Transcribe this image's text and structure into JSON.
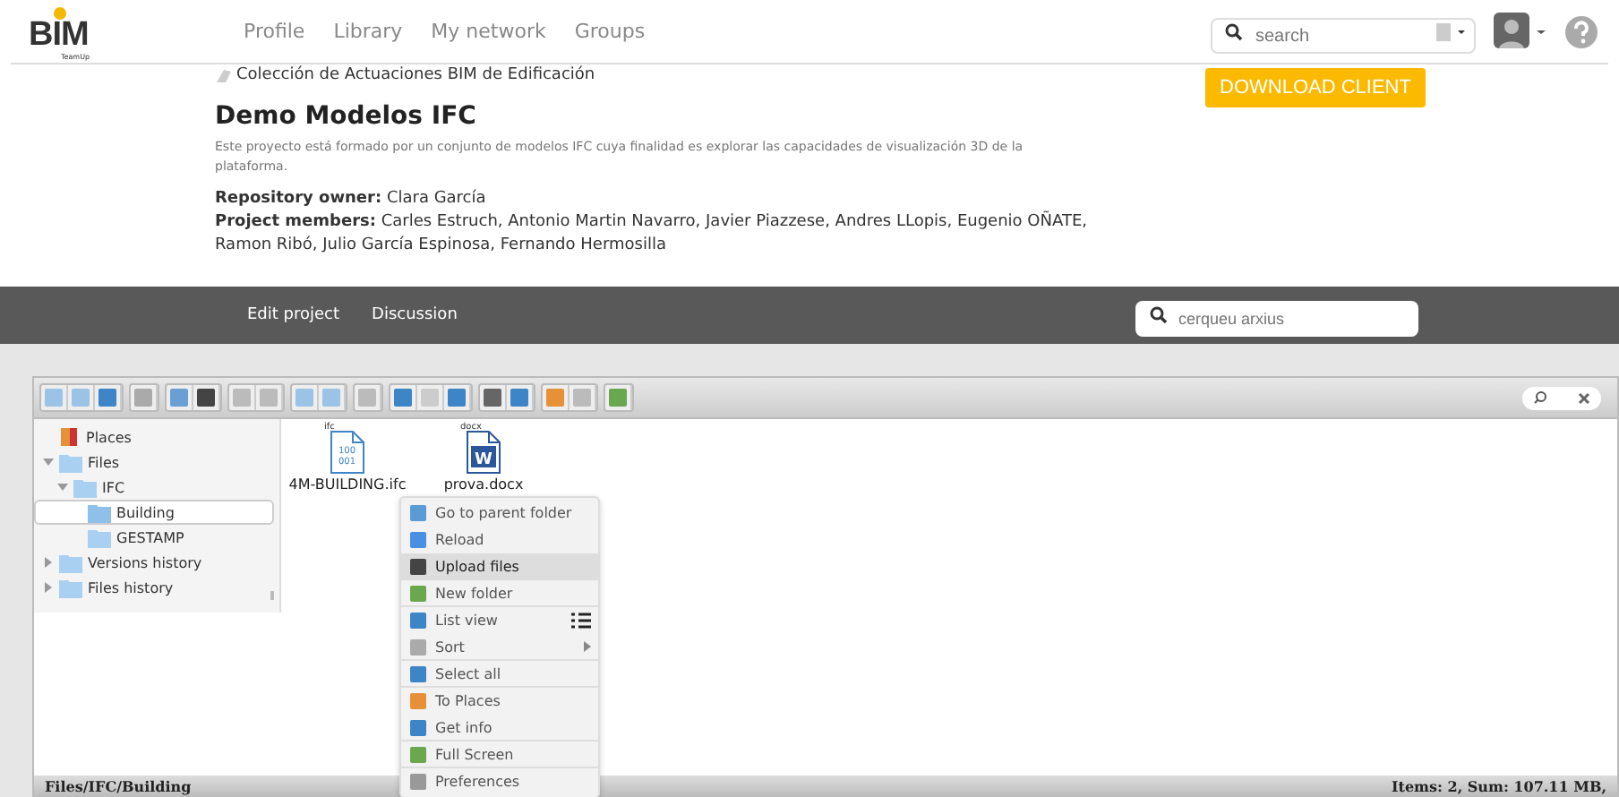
{
  "logo": {
    "text": "BIM",
    "subtitle": "TeamUp"
  },
  "nav": [
    {
      "label": "Profile"
    },
    {
      "label": "Library"
    },
    {
      "label": "My network"
    },
    {
      "label": "Groups"
    }
  ],
  "search": {
    "placeholder": "search"
  },
  "download_button": "DOWNLOAD CLIENT",
  "collection": "Colección de Actuaciones BIM de Edificación",
  "project": {
    "title": "Demo Modelos IFC",
    "description": "Este proyecto está formado por un conjunto de modelos IFC cuya finalidad es explorar las capacidades de visualización 3D de la plataforma.",
    "owner": "**Repository owner:** Clara García",
    "members": "**Project members:** Carles Estruch, Antonio Martin Navarro, Javier Piazzese, Andres LLopis, Eugenio OÑATE, Ramon Ribó, Julio García Espinosa, Fernando Hermosilla"
  },
  "project_tabs": [
    {
      "label": "Edit project"
    },
    {
      "label": "Discussion"
    }
  ],
  "file_search": {
    "placeholder": "cerqueu arxius"
  },
  "tree": [
    {
      "label": "Places",
      "kind": "places",
      "selected": false
    },
    {
      "label": "Files",
      "kind": "folder",
      "expanded": true,
      "selected": false,
      "children": [
        {
          "label": "IFC",
          "kind": "folder",
          "expanded": true,
          "selected": false,
          "children": [
            {
              "label": "Building",
              "kind": "folder",
              "selected": true
            },
            {
              "label": "GESTAMP",
              "kind": "folder",
              "selected": false
            }
          ]
        }
      ]
    },
    {
      "label": "Versions history",
      "kind": "folder",
      "expanded": false,
      "selected": false
    },
    {
      "label": "Files history",
      "kind": "folder",
      "expanded": false,
      "selected": false
    }
  ],
  "files": [
    {
      "name": "4M-BUILDING.ifc",
      "kind": "ifc",
      "tag": "ifc",
      "icon_lines": [
        "100",
        "001"
      ]
    },
    {
      "name": "prova.docx",
      "kind": "docx",
      "tag": "docx",
      "icon_lines": [
        "W"
      ]
    }
  ],
  "context_menu": [
    {
      "label": "Go to parent folder",
      "kind": "plain",
      "highlighted": false,
      "divider_after": false
    },
    {
      "label": "Reload",
      "kind": "plain",
      "highlighted": false,
      "divider_after": false
    },
    {
      "label": "Upload files",
      "kind": "plain",
      "highlighted": true,
      "divider_after": false
    },
    {
      "label": "New folder",
      "kind": "plain",
      "highlighted": false,
      "divider_after": true
    },
    {
      "label": "List view",
      "kind": "view",
      "highlighted": false,
      "divider_after": false
    },
    {
      "label": "Sort",
      "kind": "submenu",
      "highlighted": false,
      "divider_after": true
    },
    {
      "label": "Select all",
      "kind": "plain",
      "highlighted": false,
      "divider_after": true
    },
    {
      "label": "To Places",
      "kind": "plain",
      "highlighted": false,
      "divider_after": false
    },
    {
      "label": "Get info",
      "kind": "plain",
      "highlighted": false,
      "divider_after": true
    },
    {
      "label": "Full Screen",
      "kind": "plain",
      "highlighted": false,
      "divider_after": true
    },
    {
      "label": "Preferences",
      "kind": "plain",
      "highlighted": false,
      "divider_after": false
    }
  ],
  "status_bar": {
    "path": "Files/IFC/Building",
    "summary": "Items: 2, Sum: 107.11 MB,"
  }
}
